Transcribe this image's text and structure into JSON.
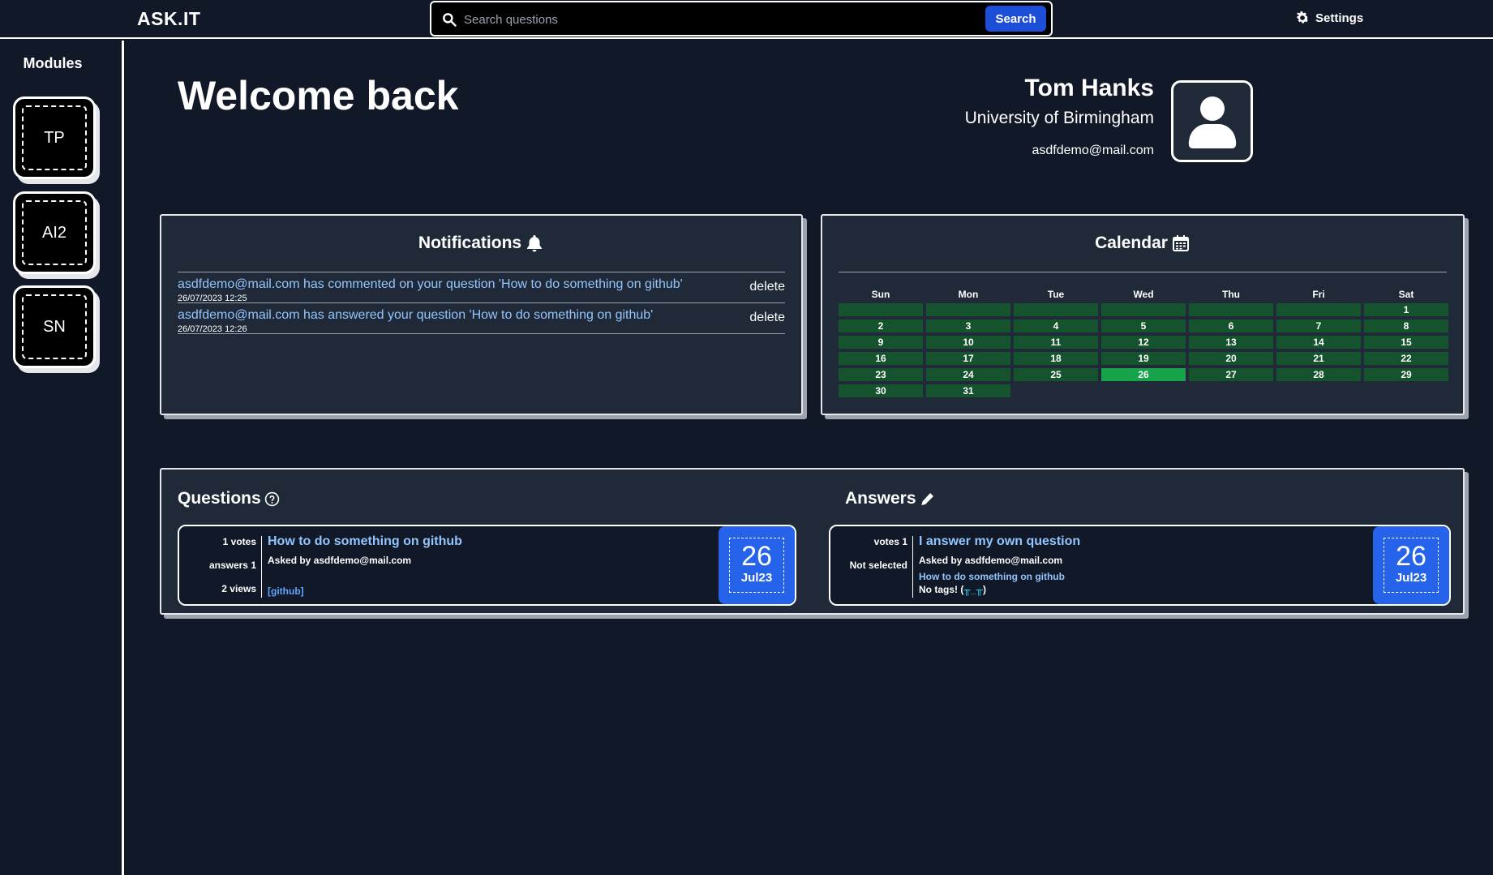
{
  "header": {
    "logo": "ASK.IT",
    "search_placeholder": "Search questions",
    "search_button": "Search",
    "settings_label": "Settings"
  },
  "sidebar": {
    "title": "Modules",
    "modules": [
      {
        "label": "TP"
      },
      {
        "label": "AI2"
      },
      {
        "label": "SN"
      }
    ]
  },
  "welcome": "Welcome back",
  "profile": {
    "name": "Tom Hanks",
    "university": "University of Birmingham",
    "email": "asdfdemo@mail.com"
  },
  "notifications": {
    "title": "Notifications",
    "items": [
      {
        "message": "asdfdemo@mail.com has commented on your question 'How to do something on github'",
        "time": "26/07/2023 12:25",
        "delete": "delete"
      },
      {
        "message": "asdfdemo@mail.com has answered your question 'How to do something on github'",
        "time": "26/07/2023 12:26",
        "delete": "delete"
      }
    ]
  },
  "calendar": {
    "title": "Calendar",
    "weekdays": [
      "Sun",
      "Mon",
      "Tue",
      "Wed",
      "Thu",
      "Fri",
      "Sat"
    ],
    "leading_blank": 6,
    "days": [
      "1",
      "2",
      "3",
      "4",
      "5",
      "6",
      "7",
      "8",
      "9",
      "10",
      "11",
      "12",
      "13",
      "14",
      "15",
      "16",
      "17",
      "18",
      "19",
      "20",
      "21",
      "22",
      "23",
      "24",
      "25",
      "26",
      "27",
      "28",
      "29",
      "30",
      "31"
    ],
    "today": "26",
    "cell_color": "#14532d",
    "today_color": "#16a34a"
  },
  "questions": {
    "title": "Questions",
    "card": {
      "votes": "1 votes",
      "answers": "answers 1",
      "views": "2 views",
      "title": "How to do something on github",
      "asked_by": "Asked by asdfdemo@mail.com",
      "tag": "[github]",
      "day": "26",
      "month": "Jul23"
    }
  },
  "answers": {
    "title": "Answers",
    "card": {
      "votes": "votes 1",
      "status": "Not selected",
      "title": "I answer my own question",
      "asked_by": "Asked by asdfdemo@mail.com",
      "question_link": "How to do something on github",
      "no_tags": "No tags! (",
      "no_tags_emoticon": "╥_╥",
      "no_tags_end": ")",
      "day": "26",
      "month": "Jul23"
    }
  },
  "colors": {
    "background": "#111827",
    "panel": "#1f2937",
    "accent_blue": "#2563eb",
    "link": "#93c5fd"
  }
}
